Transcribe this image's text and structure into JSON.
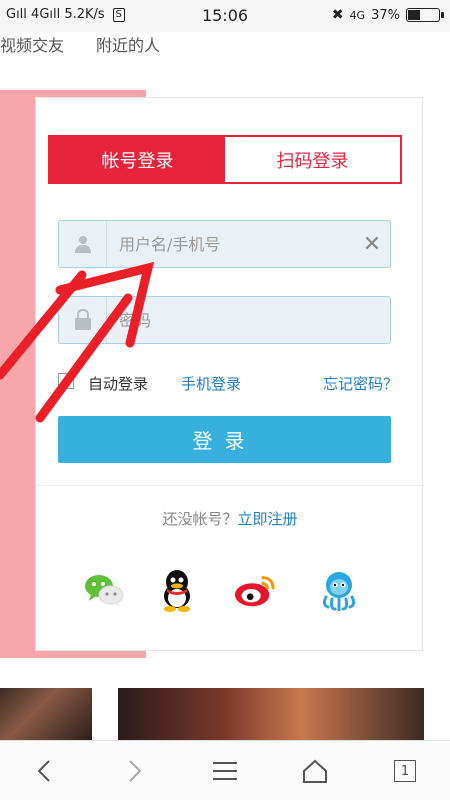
{
  "status_bar": {
    "left_text": "Gıll 4Gıll 5.2K/s",
    "time": "15:06",
    "network": "4G",
    "battery": "37%",
    "battery_level": 0.37
  },
  "top_links": [
    "视频交友",
    "附近的人"
  ],
  "login": {
    "tabs": [
      {
        "label": "帐号登录",
        "active": true
      },
      {
        "label": "扫码登录",
        "active": false
      }
    ],
    "username_placeholder": "用户名/手机号",
    "password_placeholder": "密码",
    "auto_login": "自动登录",
    "phone_login": "手机登录",
    "forgot_password": "忘记密码？",
    "submit": "登录",
    "no_account": "还没帐号？",
    "register_link": "立即注册"
  },
  "social": [
    "wechat-icon",
    "qq-icon",
    "weibo-icon",
    "tencent-weibo-icon"
  ],
  "colors": {
    "accent_red": "#e8243c",
    "button_blue": "#37b0e0",
    "link_blue": "#1e7fc0",
    "pink_panel": "#f8a6aa"
  },
  "nav": {
    "tab_count": "1"
  }
}
